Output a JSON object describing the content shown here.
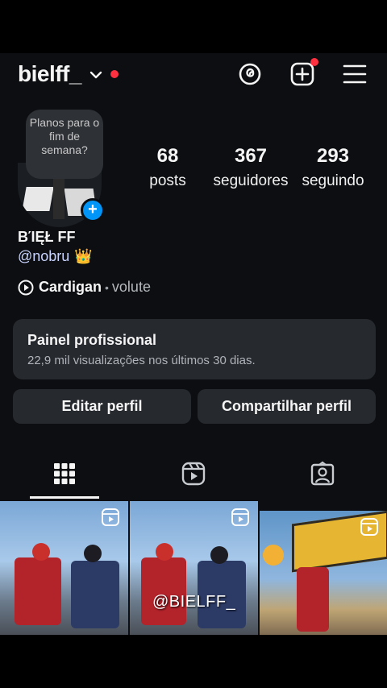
{
  "header": {
    "username": "bielff_",
    "has_notification": true
  },
  "profile": {
    "note": "Planos para o fim de semana?",
    "stats": [
      {
        "num": "68",
        "label": "posts"
      },
      {
        "num": "367",
        "label": "seguidores"
      },
      {
        "num": "293",
        "label": "seguindo"
      }
    ],
    "display_name": "ΒΊĘŁ FF",
    "handle": "@nobru",
    "handle_emoji": "👑",
    "music": {
      "song": "Cardigan",
      "separator": "•",
      "artist": "volute"
    }
  },
  "panel": {
    "title": "Painel profissional",
    "subtitle": "22,9 mil visualizações nos últimos 30 dias."
  },
  "buttons": {
    "edit": "Editar perfil",
    "share": "Compartilhar perfil"
  },
  "grid": {
    "watermark": "@BIELFF_"
  },
  "colors": {
    "background": "#0c0e11",
    "accent_blue": "#0095f6",
    "notification_red": "#ff3040",
    "panel": "#26292e"
  }
}
